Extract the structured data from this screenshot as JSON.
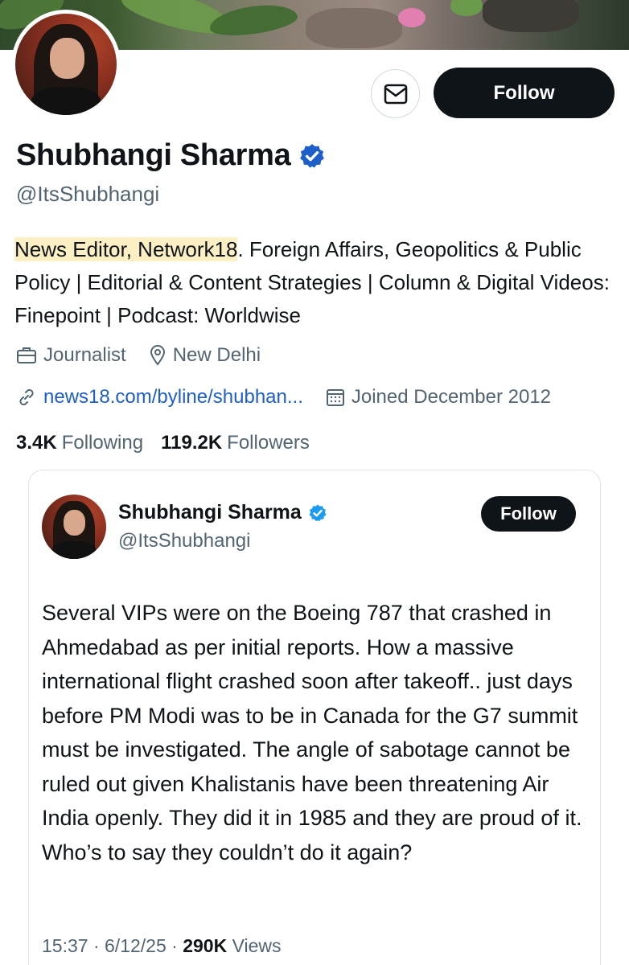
{
  "profile": {
    "name": "Shubhangi Sharma",
    "handle": "@ItsShubhangi",
    "follow_label": "Follow",
    "bio_highlight": "News Editor, Network18",
    "bio_rest": ". Foreign Affairs, Geopolitics & Public Policy | Editorial & Content Strategies | Column & Digital Videos: Finepoint | Podcast: Worldwise",
    "profession": "Journalist",
    "location": "New Delhi",
    "website": "news18.com/byline/shubhan...",
    "joined": "Joined December 2012",
    "following_count": "3.4K",
    "following_label": "Following",
    "followers_count": "119.2K",
    "followers_label": "Followers",
    "icons": {
      "message": "envelope-icon",
      "verified": "verified-badge-icon",
      "profession": "briefcase-icon",
      "location": "location-pin-icon",
      "link": "link-icon",
      "joined": "calendar-icon"
    },
    "colors": {
      "verified": "#1d5ec9",
      "highlight": "#fcefc3",
      "link": "#1d5ec9",
      "button": "#0f1419"
    }
  },
  "embedded_tweet": {
    "name": "Shubhangi Sharma",
    "handle": "@ItsShubhangi",
    "follow_label": "Follow",
    "text": "Several VIPs were on the Boeing 787 that crashed in Ahmedabad as per initial reports. How a massive international flight crashed soon after takeoff.. just days before PM Modi was to be in Canada for the G7 summit must be investigated. The angle of sabotage cannot be ruled out given Khalistanis have been threatening Air India openly. They did it in 1985 and they are proud of it. Who’s to say they couldn’t do it again?",
    "time": "15:37",
    "date": "6/12/25",
    "views_count": "290K",
    "views_label": "Views"
  }
}
